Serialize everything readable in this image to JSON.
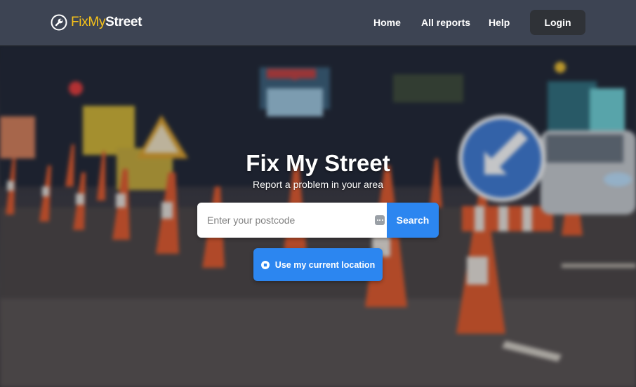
{
  "header": {
    "logo_fix": "FixMy",
    "logo_street": "Street",
    "nav": {
      "home": "Home",
      "all_reports": "All reports",
      "help": "Help"
    },
    "login": "Login"
  },
  "hero": {
    "title": "Fix My Street",
    "subtitle": "Report a problem in your area",
    "search": {
      "placeholder": "Enter your postcode",
      "value": "",
      "button": "Search"
    },
    "location_button": "Use my current location"
  },
  "colors": {
    "header_bg": "#3d4453",
    "accent_blue": "#2c86f0",
    "logo_yellow": "#f6c21a",
    "login_bg": "#2f3237"
  },
  "icons": [
    "wrench-logo-icon",
    "input-menu-icon",
    "compass-icon"
  ]
}
